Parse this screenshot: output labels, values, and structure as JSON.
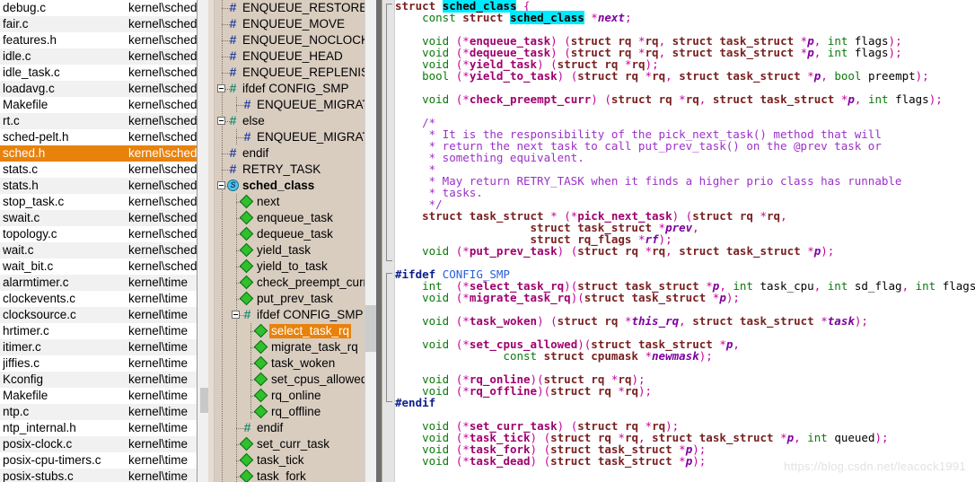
{
  "file_list": {
    "name_header": "",
    "rows": [
      {
        "name": "debug.c",
        "path": "kernel\\sched",
        "selected": false
      },
      {
        "name": "fair.c",
        "path": "kernel\\sched",
        "selected": false
      },
      {
        "name": "features.h",
        "path": "kernel\\sched",
        "selected": false
      },
      {
        "name": "idle.c",
        "path": "kernel\\sched",
        "selected": false
      },
      {
        "name": "idle_task.c",
        "path": "kernel\\sched",
        "selected": false
      },
      {
        "name": "loadavg.c",
        "path": "kernel\\sched",
        "selected": false
      },
      {
        "name": "Makefile",
        "path": "kernel\\sched",
        "selected": false
      },
      {
        "name": "rt.c",
        "path": "kernel\\sched",
        "selected": false
      },
      {
        "name": "sched-pelt.h",
        "path": "kernel\\sched",
        "selected": false
      },
      {
        "name": "sched.h",
        "path": "kernel\\sched",
        "selected": true
      },
      {
        "name": "stats.c",
        "path": "kernel\\sched",
        "selected": false
      },
      {
        "name": "stats.h",
        "path": "kernel\\sched",
        "selected": false
      },
      {
        "name": "stop_task.c",
        "path": "kernel\\sched",
        "selected": false
      },
      {
        "name": "swait.c",
        "path": "kernel\\sched",
        "selected": false
      },
      {
        "name": "topology.c",
        "path": "kernel\\sched",
        "selected": false
      },
      {
        "name": "wait.c",
        "path": "kernel\\sched",
        "selected": false
      },
      {
        "name": "wait_bit.c",
        "path": "kernel\\sched",
        "selected": false
      },
      {
        "name": "alarmtimer.c",
        "path": "kernel\\time",
        "selected": false
      },
      {
        "name": "clockevents.c",
        "path": "kernel\\time",
        "selected": false
      },
      {
        "name": "clocksource.c",
        "path": "kernel\\time",
        "selected": false
      },
      {
        "name": "hrtimer.c",
        "path": "kernel\\time",
        "selected": false
      },
      {
        "name": "itimer.c",
        "path": "kernel\\time",
        "selected": false
      },
      {
        "name": "jiffies.c",
        "path": "kernel\\time",
        "selected": false
      },
      {
        "name": "Kconfig",
        "path": "kernel\\time",
        "selected": false
      },
      {
        "name": "Makefile",
        "path": "kernel\\time",
        "selected": false
      },
      {
        "name": "ntp.c",
        "path": "kernel\\time",
        "selected": false
      },
      {
        "name": "ntp_internal.h",
        "path": "kernel\\time",
        "selected": false
      },
      {
        "name": "posix-clock.c",
        "path": "kernel\\time",
        "selected": false
      },
      {
        "name": "posix-cpu-timers.c",
        "path": "kernel\\time",
        "selected": false
      },
      {
        "name": "posix-stubs.c",
        "path": "kernel\\time",
        "selected": false
      }
    ]
  },
  "symbol_tree": {
    "rows": [
      {
        "label": "ENQUEUE_RESTORE",
        "icon": "macro-icon",
        "indent": 1,
        "expander": null,
        "bold": false,
        "selected": false
      },
      {
        "label": "ENQUEUE_MOVE",
        "icon": "macro-icon",
        "indent": 1,
        "expander": null,
        "bold": false,
        "selected": false
      },
      {
        "label": "ENQUEUE_NOCLOCK",
        "icon": "macro-icon",
        "indent": 1,
        "expander": null,
        "bold": false,
        "selected": false
      },
      {
        "label": "ENQUEUE_HEAD",
        "icon": "macro-icon",
        "indent": 1,
        "expander": null,
        "bold": false,
        "selected": false
      },
      {
        "label": "ENQUEUE_REPLENISH",
        "icon": "macro-icon",
        "indent": 1,
        "expander": null,
        "bold": false,
        "selected": false
      },
      {
        "label": "ifdef CONFIG_SMP",
        "icon": "macro-group-icon",
        "indent": 1,
        "expander": "collapse",
        "bold": false,
        "selected": false
      },
      {
        "label": "ENQUEUE_MIGRATED",
        "icon": "macro-icon",
        "indent": 2,
        "expander": null,
        "bold": false,
        "selected": false
      },
      {
        "label": "else",
        "icon": "macro-group-icon",
        "indent": 1,
        "expander": "collapse",
        "bold": false,
        "selected": false
      },
      {
        "label": "ENQUEUE_MIGRATED",
        "icon": "macro-icon",
        "indent": 2,
        "expander": null,
        "bold": false,
        "selected": false
      },
      {
        "label": "endif",
        "icon": "macro-icon",
        "indent": 1,
        "expander": null,
        "bold": false,
        "selected": false
      },
      {
        "label": "RETRY_TASK",
        "icon": "macro-icon",
        "indent": 1,
        "expander": null,
        "bold": false,
        "selected": false
      },
      {
        "label": "sched_class",
        "icon": "struct-icon",
        "indent": 1,
        "expander": "collapse",
        "bold": true,
        "selected": false
      },
      {
        "label": "next",
        "icon": "member-icon",
        "indent": 2,
        "expander": null,
        "bold": false,
        "selected": false
      },
      {
        "label": "enqueue_task",
        "icon": "member-icon",
        "indent": 2,
        "expander": null,
        "bold": false,
        "selected": false
      },
      {
        "label": "dequeue_task",
        "icon": "member-icon",
        "indent": 2,
        "expander": null,
        "bold": false,
        "selected": false
      },
      {
        "label": "yield_task",
        "icon": "member-icon",
        "indent": 2,
        "expander": null,
        "bold": false,
        "selected": false
      },
      {
        "label": "yield_to_task",
        "icon": "member-icon",
        "indent": 2,
        "expander": null,
        "bold": false,
        "selected": false
      },
      {
        "label": "check_preempt_curr",
        "icon": "member-icon",
        "indent": 2,
        "expander": null,
        "bold": false,
        "selected": false
      },
      {
        "label": "put_prev_task",
        "icon": "member-icon",
        "indent": 2,
        "expander": null,
        "bold": false,
        "selected": false
      },
      {
        "label": "ifdef CONFIG_SMP",
        "icon": "macro-group-icon",
        "indent": 2,
        "expander": "collapse",
        "bold": false,
        "selected": false
      },
      {
        "label": "select_task_rq",
        "icon": "member-icon",
        "indent": 3,
        "expander": null,
        "bold": false,
        "selected": true
      },
      {
        "label": "migrate_task_rq",
        "icon": "member-icon",
        "indent": 3,
        "expander": null,
        "bold": false,
        "selected": false
      },
      {
        "label": "task_woken",
        "icon": "member-icon",
        "indent": 3,
        "expander": null,
        "bold": false,
        "selected": false
      },
      {
        "label": "set_cpus_allowed",
        "icon": "member-icon",
        "indent": 3,
        "expander": null,
        "bold": false,
        "selected": false
      },
      {
        "label": "rq_online",
        "icon": "member-icon",
        "indent": 3,
        "expander": null,
        "bold": false,
        "selected": false
      },
      {
        "label": "rq_offline",
        "icon": "member-icon",
        "indent": 3,
        "expander": null,
        "bold": false,
        "selected": false
      },
      {
        "label": "endif",
        "icon": "macro-group-icon",
        "indent": 2,
        "expander": null,
        "bold": false,
        "selected": false
      },
      {
        "label": "set_curr_task",
        "icon": "member-icon",
        "indent": 2,
        "expander": null,
        "bold": false,
        "selected": false
      },
      {
        "label": "task_tick",
        "icon": "member-icon",
        "indent": 2,
        "expander": null,
        "bold": false,
        "selected": false
      },
      {
        "label": "task_fork",
        "icon": "member-icon",
        "indent": 2,
        "expander": null,
        "bold": false,
        "selected": false
      }
    ]
  },
  "editor": {
    "file": "sched.h",
    "highlight_token": "sched_class",
    "cursor_line": 34,
    "cursor_token": "sd_flag",
    "lines": [
      "struct sched_class {",
      "    const struct sched_class *next;",
      "",
      "    void (*enqueue_task) (struct rq *rq, struct task_struct *p, int flags);",
      "    void (*dequeue_task) (struct rq *rq, struct task_struct *p, int flags);",
      "    void (*yield_task) (struct rq *rq);",
      "    bool (*yield_to_task) (struct rq *rq, struct task_struct *p, bool preempt);",
      "",
      "    void (*check_preempt_curr) (struct rq *rq, struct task_struct *p, int flags);",
      "",
      "    /*",
      "     * It is the responsibility of the pick_next_task() method that will",
      "     * return the next task to call put_prev_task() on the @prev task or",
      "     * something equivalent.",
      "     *",
      "     * May return RETRY_TASK when it finds a higher prio class has runnable",
      "     * tasks.",
      "     */",
      "    struct task_struct * (*pick_next_task) (struct rq *rq,",
      "                    struct task_struct *prev,",
      "                    struct rq_flags *rf);",
      "    void (*put_prev_task) (struct rq *rq, struct task_struct *p);",
      "",
      "#ifdef CONFIG_SMP",
      "    int  (*select_task_rq)(struct task_struct *p, int task_cpu, int sd_flag, int flags);",
      "    void (*migrate_task_rq)(struct task_struct *p);",
      "",
      "    void (*task_woken) (struct rq *this_rq, struct task_struct *task);",
      "",
      "    void (*set_cpus_allowed)(struct task_struct *p,",
      "                const struct cpumask *newmask);",
      "",
      "    void (*rq_online)(struct rq *rq);",
      "    void (*rq_offline)(struct rq *rq);",
      "#endif",
      "",
      "    void (*set_curr_task) (struct rq *rq);",
      "    void (*task_tick) (struct rq *rq, struct task_struct *p, int queued);",
      "    void (*task_fork) (struct task_struct *p);",
      "    void (*task_dead) (struct task_struct *p);"
    ]
  },
  "watermark": {
    "text": "https://blog.csdn.net/leacock1991"
  },
  "colors": {
    "selection": "#e8820c",
    "highlight": "#00eaff",
    "tree_background": "#d9cdc0",
    "keyword": "#0b7a0b",
    "type": "#7a2020",
    "preprocessor": "#0b1f8f",
    "function": "#a0006e",
    "comment": "#9b30c9",
    "parameter": "#7d009e"
  }
}
